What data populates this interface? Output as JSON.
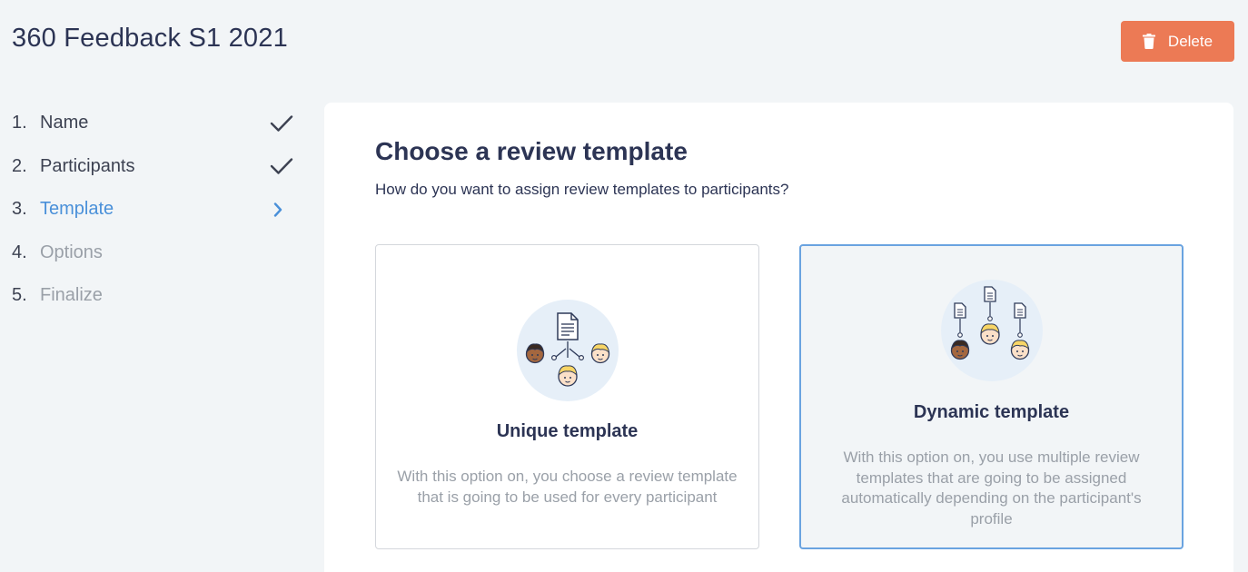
{
  "header": {
    "title": "360 Feedback S1 2021",
    "delete_label": "Delete"
  },
  "steps": [
    {
      "num": "1.",
      "label": "Name",
      "state": "done",
      "icon": "check-icon"
    },
    {
      "num": "2.",
      "label": "Participants",
      "state": "done",
      "icon": "check-icon"
    },
    {
      "num": "3.",
      "label": "Template",
      "state": "active",
      "icon": "chevron-right-icon"
    },
    {
      "num": "4.",
      "label": "Options",
      "state": "pending"
    },
    {
      "num": "5.",
      "label": "Finalize",
      "state": "pending"
    }
  ],
  "main": {
    "title": "Choose a review template",
    "subtitle": "How do you want to assign review templates to participants?",
    "options": [
      {
        "title": "Unique template",
        "description": "With this option on, you choose a review template that is going to be used for every participant",
        "selected": false,
        "icon": "single-template-people-icon"
      },
      {
        "title": "Dynamic template",
        "description": "With this option on, you use multiple review templates that are going to be assigned automatically depending on the participant's profile",
        "selected": true,
        "icon": "multiple-templates-people-icon"
      }
    ]
  },
  "colors": {
    "accent": "#4a90d9",
    "danger": "#ec7a55",
    "selected_border": "#6aa3e0",
    "muted": "#9aa0a8"
  }
}
